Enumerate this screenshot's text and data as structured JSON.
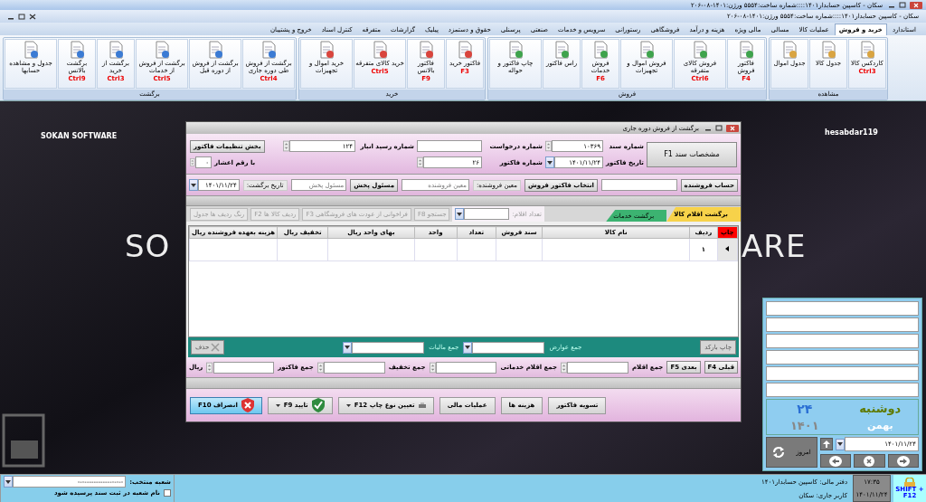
{
  "window": {
    "title": "سکان - کاسپین حسابدار۱۴۰۱::::شماره ساخت:۵۵۵۴  ورژن:۱۴۰۱-۰۸-۲۰۶"
  },
  "app_title": "سکان - کاسپین حسابدار۱۴۰۱::::شماره ساخت:۵۵۵۴  ورژن:۱۴۰۱-۰۸-۲۰۶",
  "menu_tabs": [
    {
      "label": "استاندارد",
      "selected": false
    },
    {
      "label": "خرید و فروش",
      "selected": true
    },
    {
      "label": "عملیات کالا",
      "selected": false
    },
    {
      "label": "مسالی",
      "selected": false
    },
    {
      "label": "مالی ویژه",
      "selected": false
    },
    {
      "label": "هزینه و درآمد",
      "selected": false
    },
    {
      "label": "فروشگاهی",
      "selected": false
    },
    {
      "label": "رستورانی",
      "selected": false
    },
    {
      "label": "سرویس و خدمات",
      "selected": false
    },
    {
      "label": "صنعتی",
      "selected": false
    },
    {
      "label": "پرسنلی",
      "selected": false
    },
    {
      "label": "حقوق و دستمزد",
      "selected": false
    },
    {
      "label": "پیلیک",
      "selected": false
    },
    {
      "label": "گزارشات",
      "selected": false
    },
    {
      "label": "متفرقه",
      "selected": false
    },
    {
      "label": "کنترل اسناد",
      "selected": false
    },
    {
      "label": "خروج و پشتیبان",
      "selected": false
    }
  ],
  "ribbon_groups": [
    {
      "title": "مشاهده",
      "buttons": [
        {
          "label": "کاردکس کالا",
          "shortcut": "Ctrl3"
        },
        {
          "label": "جدول کالا"
        },
        {
          "label": "جدول اموال"
        }
      ]
    },
    {
      "title": "فروش",
      "buttons": [
        {
          "label": "فاکتور فروش",
          "shortcut": "F4"
        },
        {
          "label": "فروش کالای متفرقه",
          "shortcut": "Ctrl6"
        },
        {
          "label": "فروش اموال و تجهیزات"
        },
        {
          "label": "فروش خدمات",
          "shortcut": "F6"
        },
        {
          "label": "راس فاکتور"
        },
        {
          "label": "چاپ فاکتور و حواله"
        }
      ]
    },
    {
      "title": "خرید",
      "buttons": [
        {
          "label": "فاکتور خرید",
          "shortcut": "F3"
        },
        {
          "label": "فاکتور بالانس",
          "shortcut": "F9"
        },
        {
          "label": "خرید کالای متفرقه",
          "shortcut": "Ctrl5"
        },
        {
          "label": "خرید اموال و تجهیزات"
        }
      ]
    },
    {
      "title": "برگشت",
      "buttons": [
        {
          "label": "برگشت از فروش طی دوره جاری",
          "shortcut": "Ctrl4"
        },
        {
          "label": "برگشت از فروش از دوره قبل"
        },
        {
          "label": "برگشت از فروش از خدمات",
          "shortcut": "Ctrl5"
        },
        {
          "label": "برگشت از خرید",
          "shortcut": "Ctrl3"
        },
        {
          "label": "برگشت بالانس",
          "shortcut": "Ctrl9"
        },
        {
          "label": "جدول و مشاهده حسابها"
        }
      ]
    }
  ],
  "desktop": {
    "brand": "SOKAN SOFTWARE",
    "user": "hesabdar119",
    "watermark_left": "SO",
    "watermark_right": "ARE"
  },
  "dialog": {
    "title": "برگشت از فروش دوره جاری",
    "doc_button": "مشخصات سند F1",
    "doc_number": {
      "label": "شماره سند",
      "value": "۱۰۳۶۹"
    },
    "invoice_date": {
      "label": "تاریخ فاکتور",
      "value": "۱۴۰۱/۱۱/۲۴"
    },
    "request_number": {
      "label": "شماره درخواست"
    },
    "invoice_number": {
      "label": "شماره فاکتور",
      "value": "۲۶"
    },
    "warehouse_receipt": {
      "label": "شماره رسید انبار",
      "value": "۱۲۴"
    },
    "settings_button": "بخش تنظیمات فاکتور",
    "decimals": {
      "label": "با رقم اعشار",
      "value": "۰"
    },
    "seller_account_button": "حساب فروشنده",
    "select_invoice_button": "انتخاب فاکتور فروش",
    "seller_label": "معین فروشنده:",
    "seller_placeholder": "معین فروشنده",
    "distributor_button": "مسئول پخش",
    "distributor_placeholder": "مسئول پخش",
    "return_date": {
      "label": "تاریخ برگشت:",
      "value": "۱۴۰۱/۱۱/۲۴"
    },
    "tabs": [
      {
        "label": "برگشت اقلام کالا",
        "selected": true,
        "color": "#f7d24a"
      },
      {
        "label": "برگشت خدمات",
        "selected": false,
        "color": "#3cb371"
      }
    ],
    "item_count_label": "تعداد اقلام:",
    "tools": [
      {
        "label": "جستجو F8",
        "disabled": true
      },
      {
        "label": "فراخوانی از عودت های فروشگاهی F3",
        "disabled": true
      },
      {
        "label": "ردیف کالا ها F2",
        "disabled": true
      },
      {
        "label": "رنگ ردیف ها جدول",
        "disabled": true
      }
    ],
    "columns": [
      "چاپ",
      "ردیف",
      "نام کالا",
      "سند فروش",
      "تعداد",
      "واحد",
      "بهای واحد  ریال",
      "تخفیف  ریال",
      "هزینه بعهده فروشنده  ریال"
    ],
    "rows": [
      {
        "row_number": "۱",
        "current": true
      }
    ],
    "barcode_button": {
      "label": "چاپ بارکد",
      "disabled": true
    },
    "charges_label": "جمع عوارض",
    "tax_label": "جمع مالیات",
    "delete_button": {
      "label": "حذف",
      "disabled": true
    },
    "prev_button": "قبلی F4",
    "next_button": "بعدی F5",
    "totals": [
      {
        "label": "جمع اقلام"
      },
      {
        "label": "جمع اقلام خدماتی"
      },
      {
        "label": "جمع تخفیف"
      },
      {
        "label": "جمع فاکتور"
      }
    ],
    "currency": "ریال",
    "footer_buttons": [
      {
        "label": "تسویه فاکتور",
        "kind": "plain"
      },
      {
        "label": "هزینه ها",
        "kind": "plain"
      },
      {
        "label": "عملیات مالی",
        "kind": "plain"
      },
      {
        "label": "تعیین نوع چاپ F12",
        "kind": "print"
      },
      {
        "label": "تایید F9",
        "kind": "confirm"
      },
      {
        "label": "انصراف F10",
        "kind": "cancel"
      }
    ]
  },
  "calendar_panel": {
    "day_name": "دوشنبه",
    "day": "۲۴",
    "month": "بهمن",
    "year": "۱۴۰۱",
    "today_button": "امروز",
    "date_value": "۱۴۰۱/۱۱/۲۴"
  },
  "status_bar": {
    "branch_label": "شعبه منتخب:",
    "branch_value": "--------------------",
    "ask_branch": {
      "label": "نام شعبه در ثبت سند پرسیده شود",
      "checked": false
    },
    "ledger": "دفتر مالی: کاسپین حسابدار۱۴۰۱",
    "user": "کاربر جاری: سکان",
    "time": "۱۷:۳۵",
    "date": "۱۴۰۱/۱۱/۲۴",
    "lock_hint": "SHIFT + F12"
  }
}
